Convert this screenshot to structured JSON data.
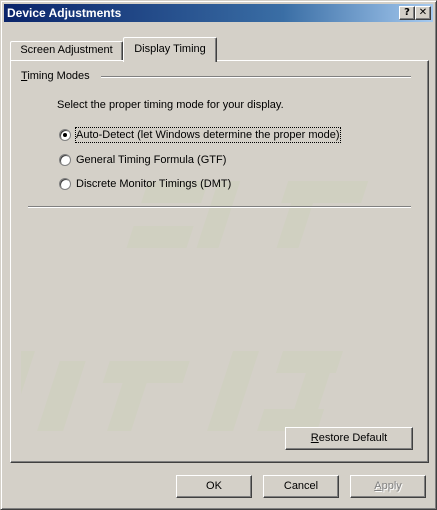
{
  "window": {
    "title": "Device Adjustments",
    "help_button": "?",
    "close_button": "✕"
  },
  "tabs": [
    {
      "label": "Screen Adjustment",
      "active": false
    },
    {
      "label": "Display Timing",
      "active": true
    }
  ],
  "group": {
    "title_mnemonic": "T",
    "title_rest": "iming Modes",
    "instruction": "Select the proper timing mode for your display."
  },
  "radios": [
    {
      "label": "Auto-Detect (let Windows determine the proper mode)",
      "checked": true
    },
    {
      "label": "General Timing Formula (GTF)",
      "checked": false
    },
    {
      "label": "Discrete Monitor Timings (DMT)",
      "checked": false
    }
  ],
  "buttons": {
    "restore_mnemonic": "R",
    "restore_rest": "estore Default",
    "ok": "OK",
    "cancel": "Cancel",
    "apply_mnemonic": "A",
    "apply_rest": "pply"
  },
  "colors": {
    "title_start": "#0a246a",
    "title_end": "#a6caf0",
    "face": "#d4d0c8"
  }
}
